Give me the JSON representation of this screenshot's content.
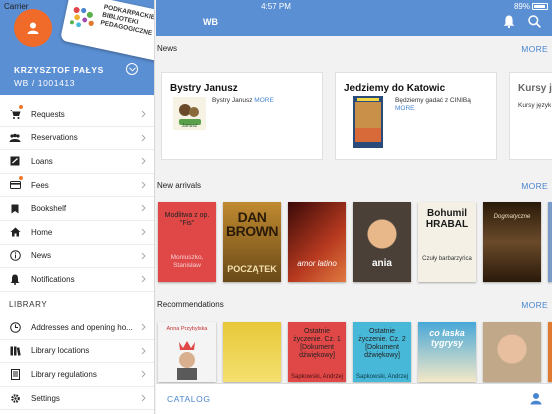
{
  "status_bar": {
    "carrier": "Carrier",
    "time": "4:57 PM",
    "battery": "89%"
  },
  "sidebar": {
    "logo_lines": [
      "PODKARPACKIE",
      "BIBLIOTEKI",
      "PEDAGOGICZNE"
    ],
    "user_name": "KRZYSZTOF PAŁYS",
    "user_id": "WB / 1001413",
    "items": [
      {
        "label": "Requests",
        "icon": "cart-icon",
        "badge": true
      },
      {
        "label": "Reservations",
        "icon": "people-icon",
        "badge": false
      },
      {
        "label": "Loans",
        "icon": "loan-icon",
        "badge": false
      },
      {
        "label": "Fees",
        "icon": "card-icon",
        "badge": true
      },
      {
        "label": "Bookshelf",
        "icon": "bookmark-icon",
        "badge": false
      },
      {
        "label": "Home",
        "icon": "home-icon",
        "badge": false
      },
      {
        "label": "News",
        "icon": "info-icon",
        "badge": false
      },
      {
        "label": "Notifications",
        "icon": "bell-icon",
        "badge": false
      }
    ],
    "library_heading": "LIBRARY",
    "library_items": [
      {
        "label": "Addresses and opening ho...",
        "icon": "clock-icon"
      },
      {
        "label": "Library locations",
        "icon": "books-icon"
      },
      {
        "label": "Library regulations",
        "icon": "document-icon"
      },
      {
        "label": "Settings",
        "icon": "gear-icon"
      }
    ]
  },
  "main": {
    "title": "WB",
    "news": {
      "heading": "News",
      "more": "MORE",
      "cards": [
        {
          "title": "Bystry Janusz",
          "body": "Bystry Janusz",
          "more": "MORE"
        },
        {
          "title": "Jedziemy do Katowic",
          "body": "Będziemy gadać z CINIBą",
          "more": "MORE"
        },
        {
          "title": "Kursy j",
          "body": "Kursy język"
        }
      ]
    },
    "new_arrivals": {
      "heading": "New arrivals",
      "more": "MORE",
      "covers": [
        {
          "title": "Modlitwa z op. \"Fis\"",
          "author": "Moniuszko, Stanisław",
          "color": "#e04848"
        },
        {
          "title": "DAN BROWN",
          "subtitle": "POCZĄTEK",
          "color": "#b07a28"
        },
        {
          "title": "amor latino",
          "color": "#8a2a18"
        },
        {
          "title": "ania",
          "color": "#3a3a3a"
        },
        {
          "title": "Bohumil HRABAL",
          "subtitle": "Czuły barbarzyńca",
          "color": "#f4f0e6"
        },
        {
          "title": "Dogmatyczne",
          "color": "#3a2a1a"
        }
      ]
    },
    "recommendations": {
      "heading": "Recommendations",
      "more": "MORE",
      "covers": [
        {
          "title": "Anna Przybylska",
          "color": "#f4f4f4"
        },
        {
          "title": "",
          "color": "#f0d848"
        },
        {
          "title": "Ostatnie życzenie. Cz. 1 [Dokument dźwiękowy]",
          "author": "Sapkowski, Andrzej",
          "color": "#e04848"
        },
        {
          "title": "Ostatnie życzenie. Cz. 2 [Dokument dźwiękowy]",
          "author": "Sapkowski, Andrzej",
          "color": "#48b8d8"
        },
        {
          "title": "co łaska tygrysy",
          "color": "#48a8d8"
        },
        {
          "title": "",
          "color": "#c0a888"
        }
      ]
    },
    "bottom": {
      "catalog": "CATALOG"
    }
  }
}
